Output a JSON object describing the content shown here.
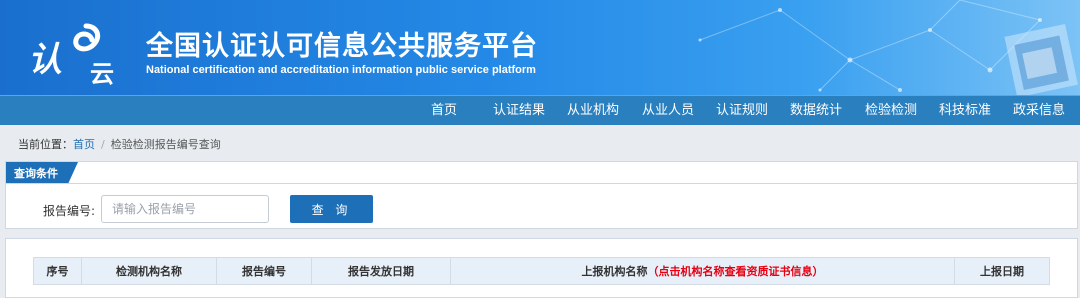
{
  "header": {
    "logo": {
      "part1": "认",
      "part2": "云"
    },
    "title": "全国认证认可信息公共服务平台",
    "subtitle": "National certification and accreditation information public service platform"
  },
  "nav": {
    "items": [
      {
        "label": "首页"
      },
      {
        "label": "认证结果"
      },
      {
        "label": "从业机构"
      },
      {
        "label": "从业人员"
      },
      {
        "label": "认证规则"
      },
      {
        "label": "数据统计"
      },
      {
        "label": "检验检测"
      },
      {
        "label": "科技标准"
      },
      {
        "label": "政采信息"
      }
    ]
  },
  "breadcrumb": {
    "prefix": "当前位置：",
    "home": "首页",
    "separator": "/",
    "current": "检验检测报告编号查询"
  },
  "query_panel": {
    "tab_label": "查询条件",
    "field_label": "报告编号:",
    "input_value": "",
    "input_placeholder": "请输入报告编号",
    "button_label": "查 询"
  },
  "results_table": {
    "columns": [
      {
        "label": "序号"
      },
      {
        "label": "检测机构名称"
      },
      {
        "label": "报告编号"
      },
      {
        "label": "报告发放日期"
      },
      {
        "label": "上报机构名称",
        "hint": "（点击机构名称查看资质证书信息）"
      },
      {
        "label": "上报日期"
      }
    ],
    "rows": []
  },
  "colors": {
    "header_start": "#1a6fce",
    "header_end": "#7cc3f6",
    "nav_bg": "#2a7fbf",
    "button_bg": "#1d6fb8",
    "table_header_bg": "#e7f0f9",
    "hint_red": "#e60012"
  }
}
